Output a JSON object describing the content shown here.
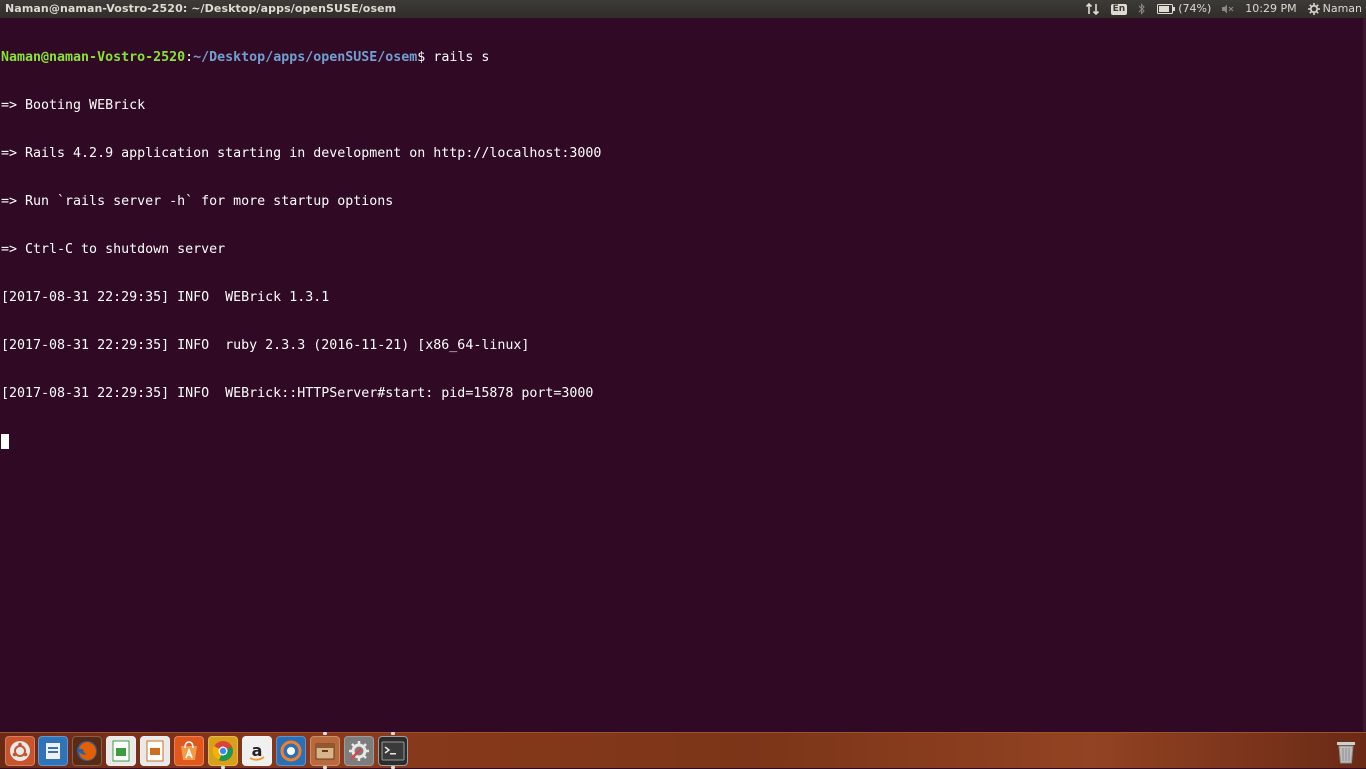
{
  "top_panel": {
    "window_title": "Naman@naman-Vostro-2520: ~/Desktop/apps/openSUSE/osem",
    "keyboard_layout": "En",
    "battery": "(74%)",
    "time": "10:29 PM",
    "user": "Naman"
  },
  "terminal": {
    "prompt": {
      "user_host": "Naman@naman-Vostro-2520",
      "separator": ":",
      "path": "~/Desktop/apps/openSUSE/osem",
      "symbol": "$",
      "command": " rails s"
    },
    "lines": [
      "=> Booting WEBrick",
      "=> Rails 4.2.9 application starting in development on http://localhost:3000",
      "=> Run `rails server -h` for more startup options",
      "=> Ctrl-C to shutdown server",
      "[2017-08-31 22:29:35] INFO  WEBrick 1.3.1",
      "[2017-08-31 22:29:35] INFO  ruby 2.3.3 (2016-11-21) [x86_64-linux]",
      "[2017-08-31 22:29:35] INFO  WEBrick::HTTPServer#start: pid=15878 port=3000"
    ]
  },
  "launcher": {
    "apps": [
      {
        "name": "ubuntu-dash-icon",
        "color": "#c9532b"
      },
      {
        "name": "files-icon",
        "color": "#2f73b8"
      },
      {
        "name": "firefox-icon",
        "color": "#e66000"
      },
      {
        "name": "libreoffice-calc-icon",
        "color": "#3f9b3b"
      },
      {
        "name": "libreoffice-impress-icon",
        "color": "#d36b1d"
      },
      {
        "name": "software-center-icon",
        "color": "#e0581c"
      },
      {
        "name": "chrome-icon",
        "color": "#e0b020"
      },
      {
        "name": "amazon-icon",
        "color": "#e8e8e8"
      },
      {
        "name": "ubuntu-one-icon",
        "color": "#2b6fb6"
      },
      {
        "name": "archive-manager-icon",
        "color": "#b86a3c"
      },
      {
        "name": "system-settings-icon",
        "color": "#8f8f8f"
      },
      {
        "name": "terminal-icon",
        "color": "#2c2c2c"
      }
    ],
    "trash": {
      "name": "trash-icon"
    }
  }
}
